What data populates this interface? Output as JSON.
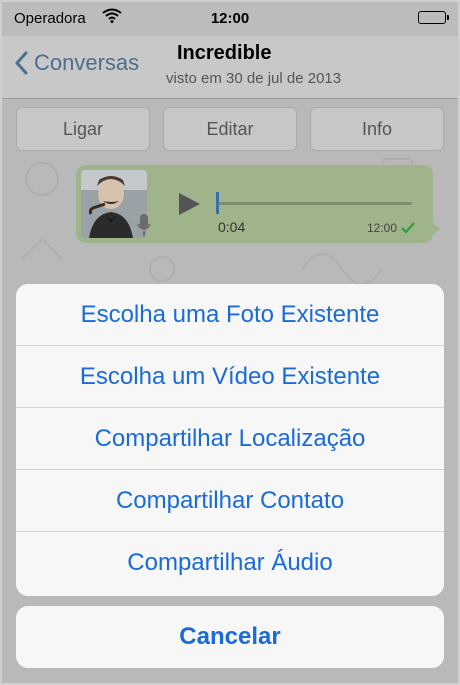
{
  "status_bar": {
    "carrier": "Operadora",
    "time": "12:00"
  },
  "nav": {
    "back_label": "Conversas",
    "title": "Incredible",
    "subtitle": "visto em 30 de jul de 2013"
  },
  "actions": {
    "call": "Ligar",
    "edit": "Editar",
    "info": "Info"
  },
  "message": {
    "type": "audio",
    "duration": "0:04",
    "time": "12:00",
    "delivered": true,
    "avatar_icon": "avatar-photo"
  },
  "action_sheet": {
    "options": [
      "Escolha uma Foto Existente",
      "Escolha um Vídeo Existente",
      "Compartilhar Localização",
      "Compartilhar Contato",
      "Compartilhar Áudio"
    ],
    "cancel": "Cancelar"
  },
  "colors": {
    "accent": "#1a6bd8",
    "bubble": "#a0b48c",
    "check": "#2e9e3a"
  }
}
